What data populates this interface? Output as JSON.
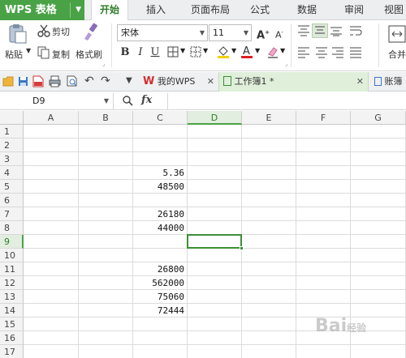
{
  "app": {
    "name": "WPS 表格"
  },
  "menu_tabs": [
    "开始",
    "插入",
    "页面布局",
    "公式",
    "数据",
    "审阅",
    "视图"
  ],
  "active_menu_tab": "开始",
  "ribbon": {
    "paste_label": "粘贴",
    "cut_label": "剪切",
    "copy_label": "复制",
    "format_painter_label": "格式刷",
    "font_name": "宋体",
    "font_size": "11",
    "merge_label": "合并"
  },
  "doc_tabs": [
    {
      "label": "我的WPS"
    },
    {
      "label": "工作簿1 *"
    },
    {
      "label": "账簿"
    }
  ],
  "formula_bar": {
    "name_box": "D9",
    "fx": "fx",
    "value": ""
  },
  "sheet": {
    "columns": [
      "A",
      "B",
      "C",
      "D",
      "E",
      "F",
      "G"
    ],
    "selected_column": "D",
    "rows": [
      "1",
      "2",
      "3",
      "4",
      "5",
      "6",
      "7",
      "8",
      "9",
      "10",
      "11",
      "12",
      "13",
      "14",
      "15",
      "16",
      "17"
    ],
    "selected_row": "9",
    "column_c_values": [
      "",
      "",
      "",
      "5.36",
      "48500",
      "",
      "26180",
      "44000",
      "",
      "",
      "26800",
      "562000",
      "75060",
      "72444",
      "",
      "",
      ""
    ]
  },
  "watermark": {
    "text": "Bai",
    "suffix": "经验"
  },
  "colors": {
    "accent": "#4aa246",
    "active_border": "#3d8f36"
  }
}
